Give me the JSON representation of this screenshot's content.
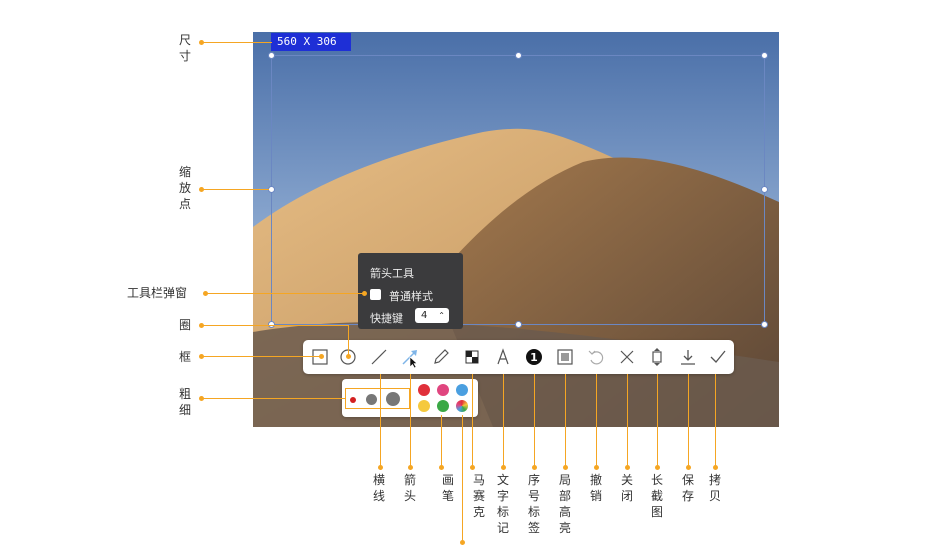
{
  "size_badge": "560  X 306",
  "popup": {
    "title": "箭头工具",
    "checkbox_label": "普通样式",
    "shortcut_label": "快捷键",
    "shortcut_value": "4"
  },
  "left_labels": {
    "size": "尺寸",
    "handles": "缩放点",
    "popup": "工具栏弹窗",
    "circle": "圈",
    "rect": "框",
    "thickness": "粗细"
  },
  "bottom_labels": {
    "line": "横线",
    "arrow": "箭头",
    "pen": "画笔",
    "mosaic": "马赛克",
    "text": "文字标记",
    "number": "序号标签",
    "highlight": "局部高亮",
    "undo": "撤销",
    "close": "关闭",
    "long": "长截图",
    "save": "保存",
    "copy": "拷贝"
  },
  "colors": {
    "accent": "#f5a623",
    "palette": [
      "#e0303a",
      "#e0457f",
      "#4a9fe0",
      "#f5c93d",
      "#3aa845",
      "#multicolor"
    ]
  }
}
